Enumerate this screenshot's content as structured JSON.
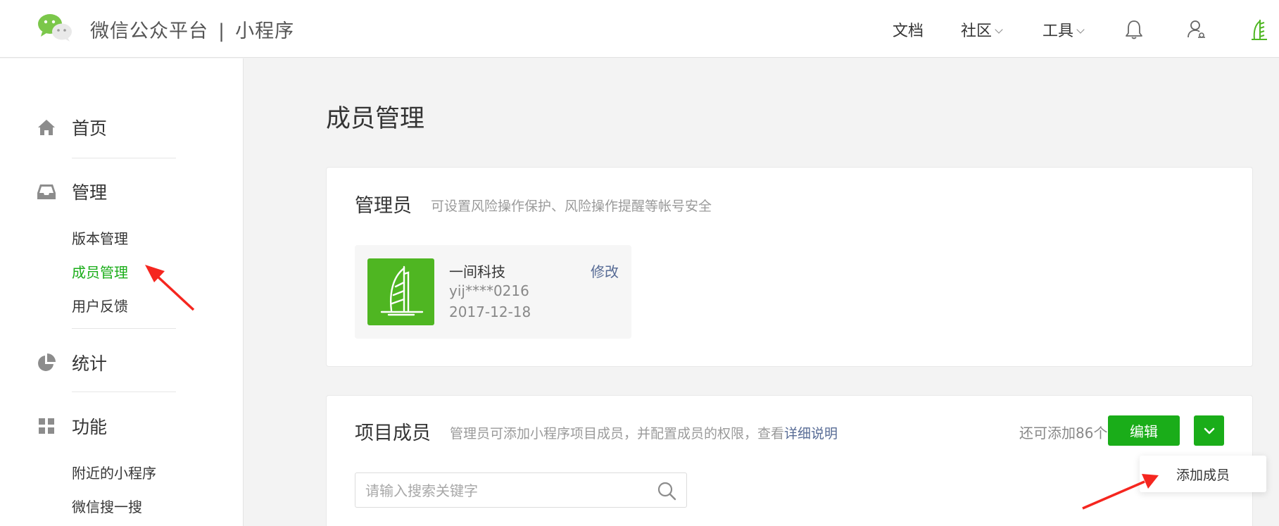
{
  "header": {
    "brand_name": "微信公众平台",
    "brand_separator": "|",
    "brand_product": "小程序",
    "nav": [
      {
        "label": "文档",
        "has_dropdown": false
      },
      {
        "label": "社区",
        "has_dropdown": true
      },
      {
        "label": "工具",
        "has_dropdown": true
      }
    ],
    "icons": [
      "bell-icon",
      "user-settings-icon",
      "account-avatar"
    ]
  },
  "sidebar": {
    "sections": [
      {
        "label": "首页",
        "icon": "home-icon",
        "items": []
      },
      {
        "label": "管理",
        "icon": "inbox-icon",
        "items": [
          {
            "label": "版本管理",
            "active": false
          },
          {
            "label": "成员管理",
            "active": true
          },
          {
            "label": "用户反馈",
            "active": false
          }
        ]
      },
      {
        "label": "统计",
        "icon": "pie-chart-icon",
        "items": []
      },
      {
        "label": "功能",
        "icon": "grid-icon",
        "items": [
          {
            "label": "附近的小程序",
            "active": false
          },
          {
            "label": "微信搜一搜",
            "active": false
          }
        ]
      }
    ]
  },
  "main": {
    "page_title": "成员管理",
    "admin_card": {
      "title": "管理员",
      "description": "可设置风险操作保护、风险操作提醒等帐号安全",
      "admin": {
        "name": "一间科技",
        "account": "yij****0216",
        "date": "2017-12-18",
        "modify_label": "修改"
      }
    },
    "members_card": {
      "title": "项目成员",
      "description": "管理员可添加小程序项目成员，并配置成员的权限，查看",
      "description_link": "详细说明",
      "remaining": "还可添加86个",
      "edit_label": "编辑",
      "search_placeholder": "请输入搜索关键字",
      "dropdown_item": "添加成员"
    }
  },
  "colors": {
    "brand_green": "#1aad19",
    "link_blue": "#576b95",
    "annotation_red": "#f5261f"
  }
}
